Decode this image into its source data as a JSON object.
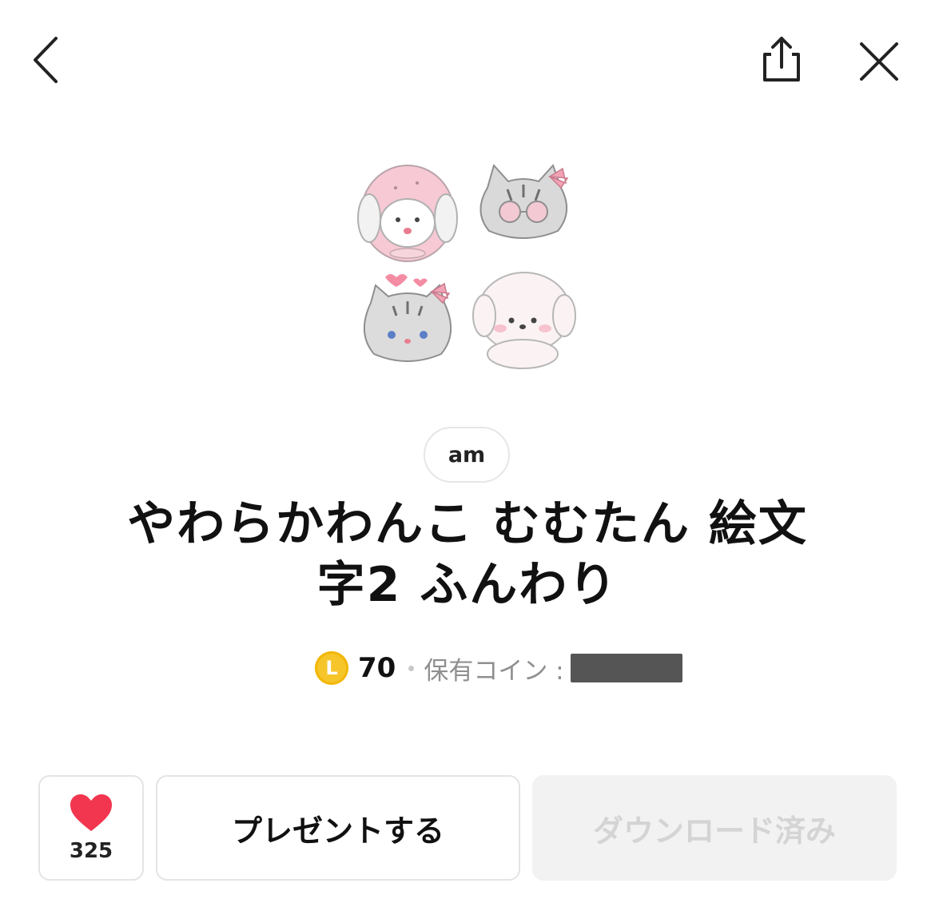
{
  "header": {
    "back_icon": "chevron-left-icon",
    "share_icon": "share-icon",
    "close_icon": "close-icon"
  },
  "preview": {
    "stickers": [
      "bunny-hood-emoji",
      "cat-sunglasses-emoji",
      "cat-bow-hearts-emoji",
      "puppy-emoji"
    ]
  },
  "author": {
    "name": "am"
  },
  "product": {
    "title_line1": "やわらかわんこ むむたん 絵文",
    "title_line2": "字2 ふんわり"
  },
  "price": {
    "coin_symbol": "L",
    "value": "70",
    "owned_label": "保有コイン :",
    "coin_color": "#f6c52a"
  },
  "actions": {
    "like_count": "325",
    "present_label": "プレゼントする",
    "download_label": "ダウンロード済み",
    "heart_color": "#f2364f"
  }
}
